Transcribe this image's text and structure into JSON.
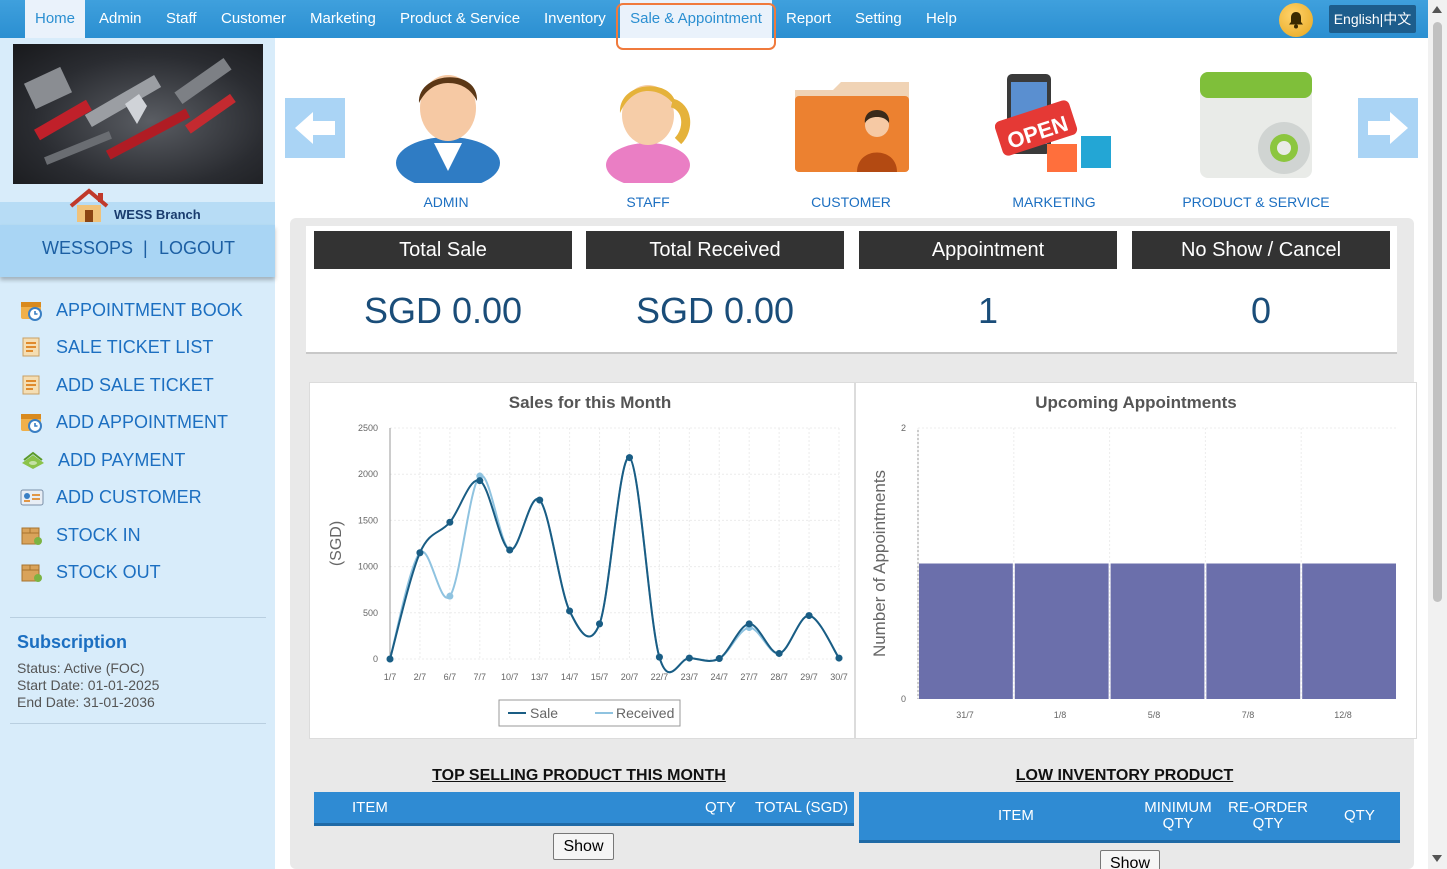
{
  "nav": {
    "items": [
      "Home",
      "Admin",
      "Staff",
      "Customer",
      "Marketing",
      "Product & Service",
      "Inventory",
      "Sale & Appointment",
      "Report",
      "Setting",
      "Help"
    ],
    "language": "English|中文"
  },
  "sidebar": {
    "branch": "WESS Branch",
    "username": "WESSOPS",
    "separator": "|",
    "logout": "LOGOUT",
    "links": [
      "APPOINTMENT BOOK",
      "SALE TICKET LIST",
      "ADD SALE TICKET",
      "ADD APPOINTMENT",
      "ADD PAYMENT",
      "ADD CUSTOMER",
      "STOCK IN",
      "STOCK OUT"
    ],
    "subscription": {
      "title": "Subscription",
      "status": "Status: Active (FOC)",
      "start": "Start Date: 01-01-2025",
      "end": "End Date: 31-01-2036"
    }
  },
  "modules": [
    "ADMIN",
    "STAFF",
    "CUSTOMER",
    "MARKETING",
    "PRODUCT & SERVICE"
  ],
  "stats": [
    {
      "label": "Total Sale",
      "value": "SGD 0.00"
    },
    {
      "label": "Total Received",
      "value": "SGD 0.00"
    },
    {
      "label": "Appointment",
      "value": "1"
    },
    {
      "label": "No Show / Cancel",
      "value": "0"
    }
  ],
  "colors": {
    "nav": "#2b8fd1",
    "sale_line": "#1a5d84",
    "received_line": "#8fc3e0",
    "bar": "#6b6fab",
    "highlight": "#f07a3c"
  },
  "chart_data": [
    {
      "type": "line",
      "title": "Sales for this Month",
      "ylabel": "(SGD)",
      "xlabel": "",
      "ylim": [
        0,
        2500
      ],
      "yticks": [
        0,
        500,
        1000,
        1500,
        2000,
        2500
      ],
      "categories": [
        "1/7",
        "2/7",
        "6/7",
        "7/7",
        "10/7",
        "13/7",
        "14/7",
        "15/7",
        "20/7",
        "22/7",
        "23/7",
        "24/7",
        "27/7",
        "28/7",
        "29/7",
        "30/7"
      ],
      "series": [
        {
          "name": "Sale",
          "values": [
            0,
            1150,
            1480,
            1930,
            1180,
            1720,
            520,
            380,
            2180,
            20,
            10,
            5,
            380,
            60,
            470,
            10
          ]
        },
        {
          "name": "Received",
          "values": [
            0,
            1150,
            680,
            1980,
            1180,
            1720,
            520,
            380,
            2180,
            20,
            10,
            5,
            340,
            60,
            470,
            10
          ]
        }
      ],
      "legend": "bottom",
      "grid": true
    },
    {
      "type": "bar",
      "title": "Upcoming Appointments",
      "ylabel": "Number of Appointments",
      "xlabel": "",
      "ylim": [
        0,
        2
      ],
      "yticks": [
        0,
        2
      ],
      "tick_labels": [
        "31/7",
        "1/8",
        "5/8",
        "7/8",
        "12/8"
      ],
      "categories": [
        "",
        "",
        "",
        "",
        ""
      ],
      "values": [
        1,
        1,
        1,
        1,
        1
      ],
      "grid": true
    }
  ],
  "top_selling": {
    "title": "TOP SELLING PRODUCT THIS MONTH",
    "columns": [
      "ITEM",
      "QTY",
      "TOTAL (SGD)"
    ],
    "button": "Show"
  },
  "low_inventory": {
    "title": "LOW INVENTORY PRODUCT",
    "columns": [
      "ITEM",
      "MINIMUM QTY",
      "RE-ORDER QTY",
      "QTY"
    ],
    "button": "Show"
  }
}
